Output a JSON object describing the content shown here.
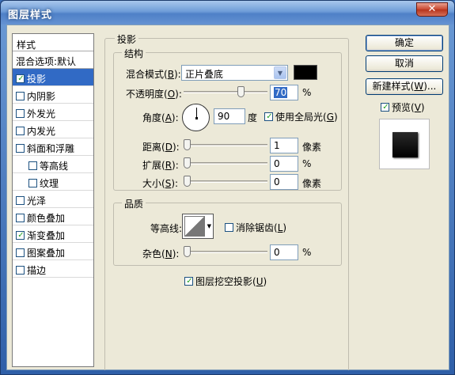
{
  "window": {
    "title": "图层样式",
    "close_glyph": "✕"
  },
  "sidebar": {
    "header": "样式",
    "blend": "混合选项:默认",
    "items": [
      {
        "label": "投影",
        "checked": true,
        "selected": true,
        "sub": false
      },
      {
        "label": "内阴影",
        "checked": false,
        "selected": false,
        "sub": false
      },
      {
        "label": "外发光",
        "checked": false,
        "selected": false,
        "sub": false
      },
      {
        "label": "内发光",
        "checked": false,
        "selected": false,
        "sub": false
      },
      {
        "label": "斜面和浮雕",
        "checked": false,
        "selected": false,
        "sub": false
      },
      {
        "label": "等高线",
        "checked": false,
        "selected": false,
        "sub": true
      },
      {
        "label": "纹理",
        "checked": false,
        "selected": false,
        "sub": true
      },
      {
        "label": "光泽",
        "checked": false,
        "selected": false,
        "sub": false
      },
      {
        "label": "颜色叠加",
        "checked": false,
        "selected": false,
        "sub": false
      },
      {
        "label": "渐变叠加",
        "checked": true,
        "selected": false,
        "sub": false
      },
      {
        "label": "图案叠加",
        "checked": false,
        "selected": false,
        "sub": false
      },
      {
        "label": "描边",
        "checked": false,
        "selected": false,
        "sub": false
      }
    ]
  },
  "shadow": {
    "group_title": "投影",
    "structure": {
      "title": "结构",
      "blend_mode_label": "混合模式",
      "blend_mode_key": "B",
      "blend_mode_value": "正片叠底",
      "shadow_color": "#000000",
      "opacity_label": "不透明度",
      "opacity_key": "O",
      "opacity_value": "70",
      "opacity_level": 70,
      "opacity_unit": "%",
      "angle_label": "角度",
      "angle_key": "A",
      "angle_value": "90",
      "angle_unit": "度",
      "global_light_label": "使用全局光",
      "global_light_key": "G",
      "global_light_checked": true,
      "distance_label": "距离",
      "distance_key": "D",
      "distance_value": "1",
      "distance_unit": "像素",
      "spread_label": "扩展",
      "spread_key": "R",
      "spread_value": "0",
      "spread_unit": "%",
      "size_label": "大小",
      "size_key": "S",
      "size_value": "0",
      "size_unit": "像素"
    },
    "quality": {
      "title": "品质",
      "contour_label": "等高线:",
      "antialias_label": "消除锯齿",
      "antialias_key": "L",
      "antialias_checked": false,
      "noise_label": "杂色",
      "noise_key": "N",
      "noise_value": "0",
      "noise_unit": "%"
    },
    "knockout_label": "图层挖空投影",
    "knockout_key": "U",
    "knockout_checked": true
  },
  "actions": {
    "ok": "确定",
    "cancel": "取消",
    "new_style": "新建样式",
    "new_style_key": "W",
    "new_style_suffix": "...",
    "preview_label": "预览",
    "preview_key": "V",
    "preview_checked": true
  }
}
